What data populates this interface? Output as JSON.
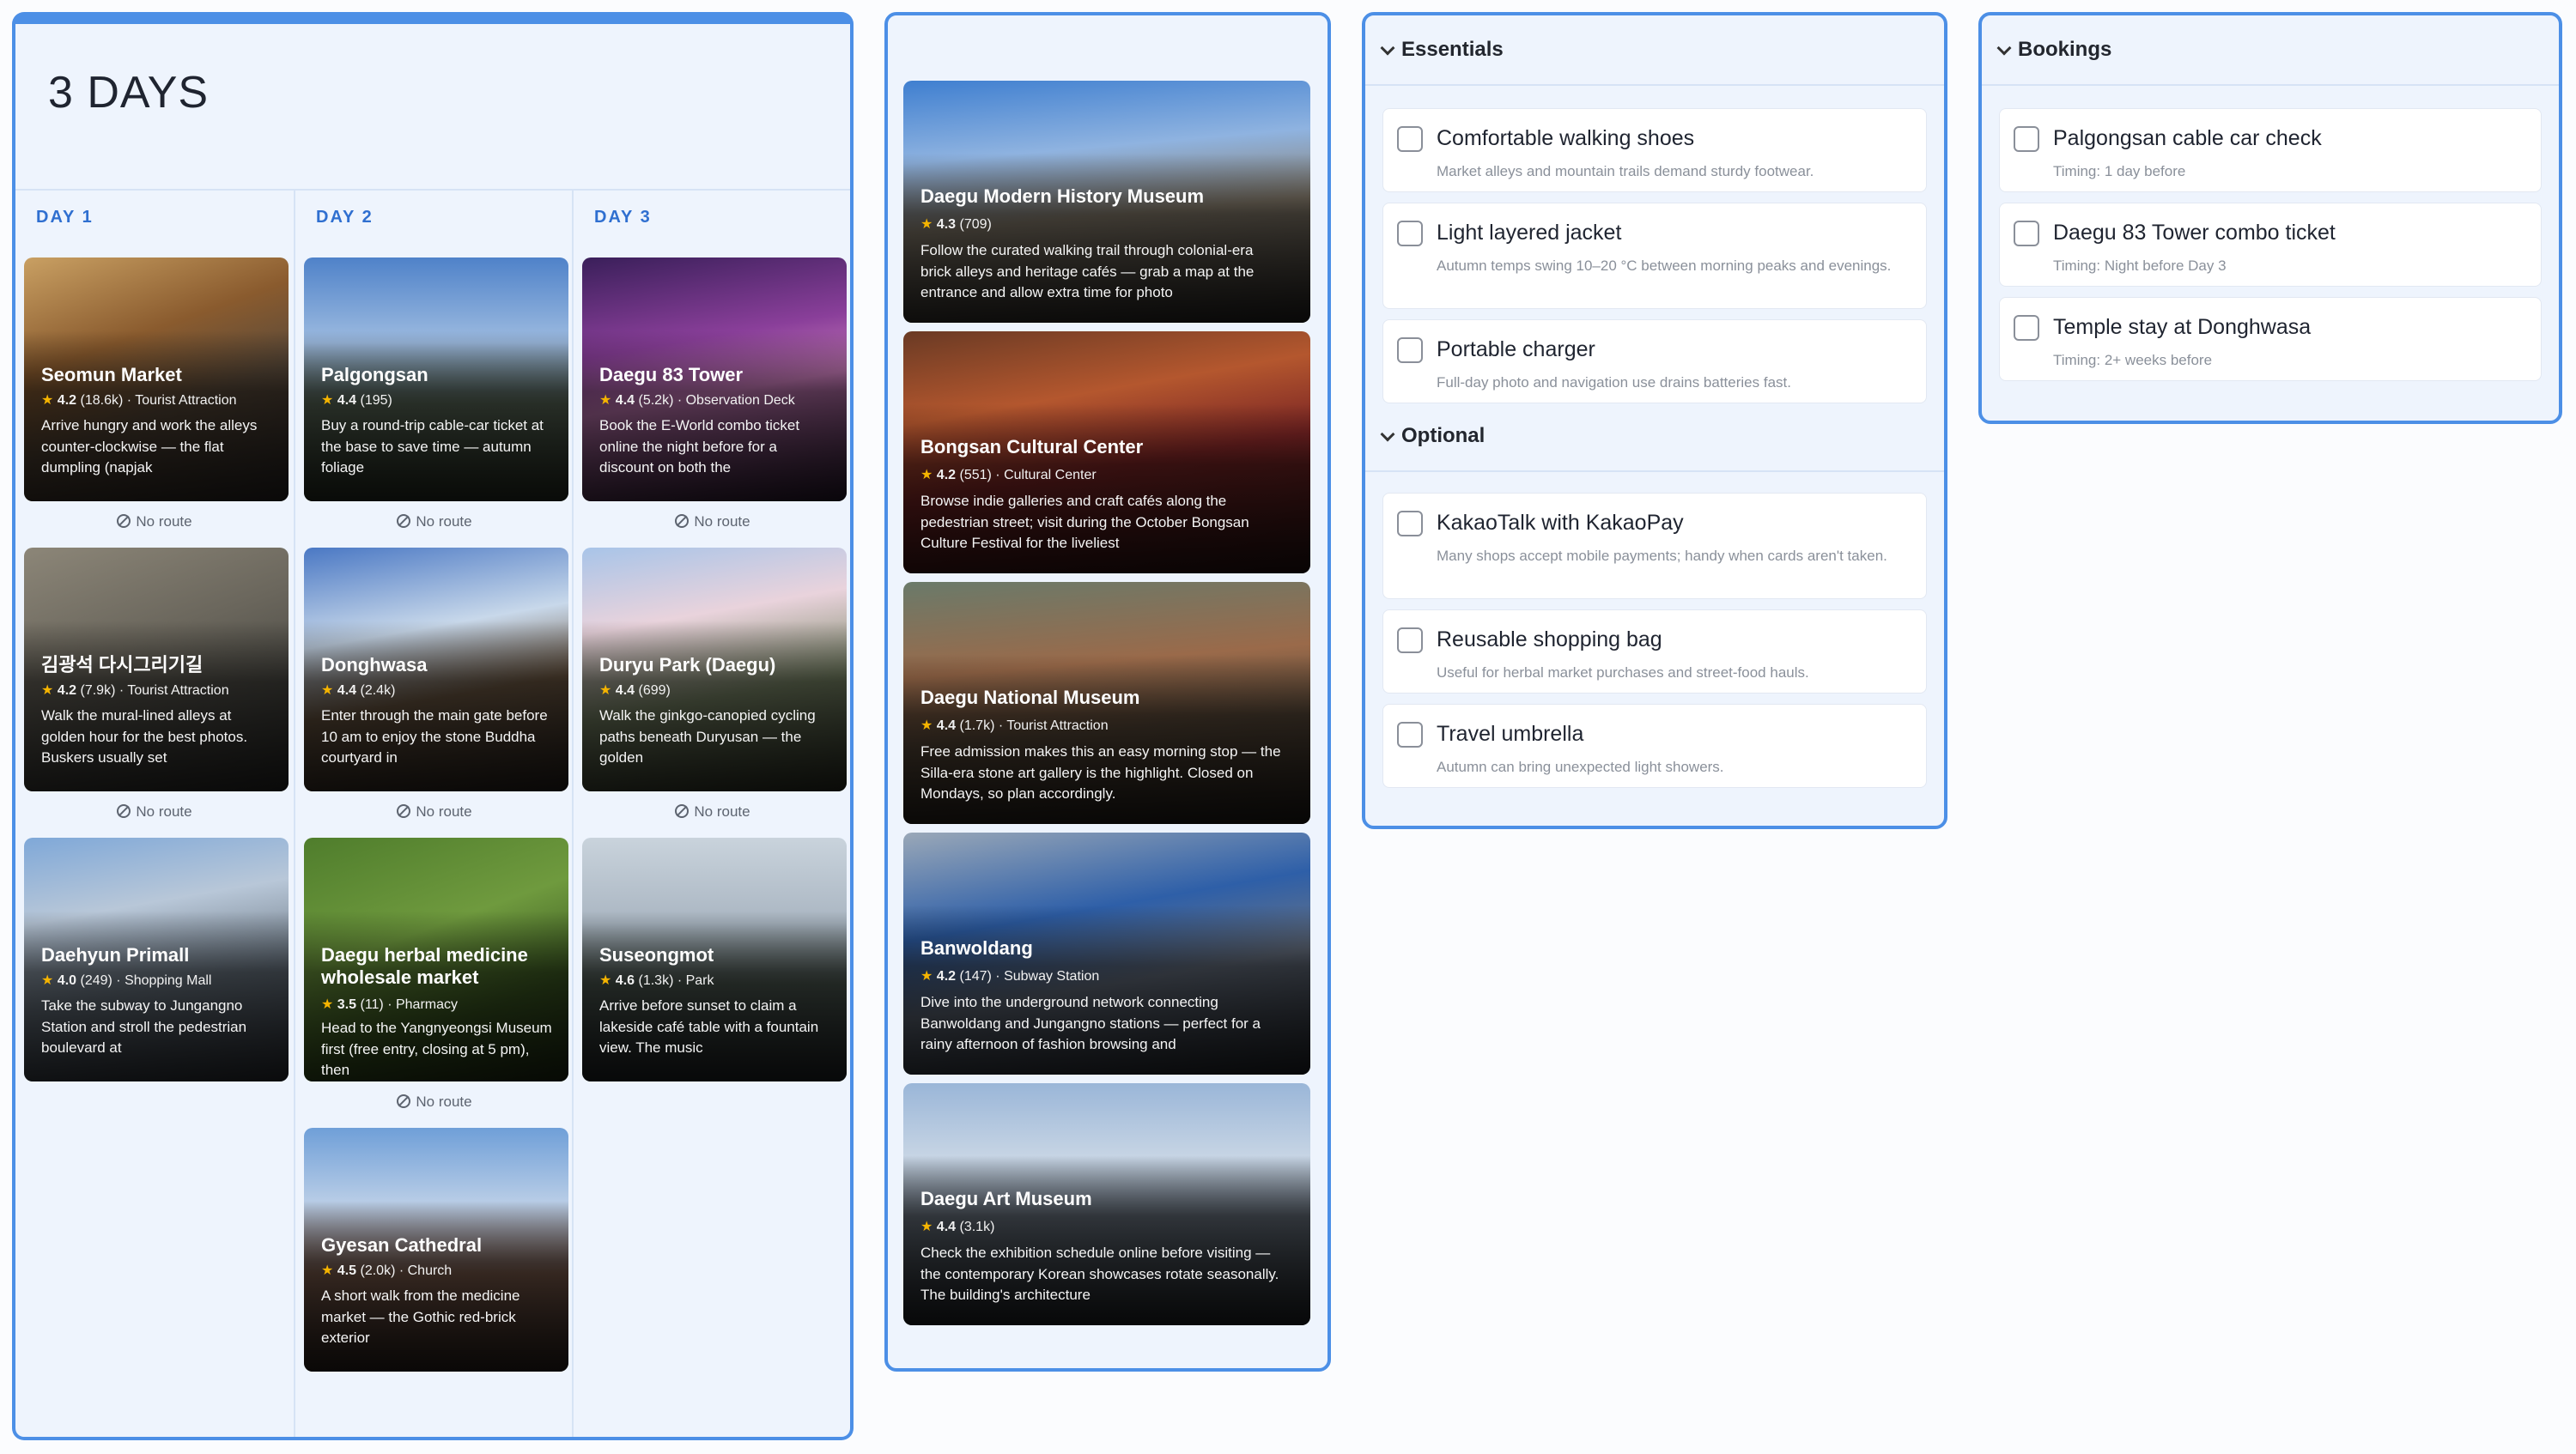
{
  "itinerary": {
    "title": "3 DAYS",
    "no_route_label": "No route",
    "days": [
      {
        "label": "DAY 1",
        "cards": [
          {
            "name": "Seomun Market",
            "rating": "4.2",
            "reviews": "(18.6k)",
            "category": "Tourist Attraction",
            "desc": "Arrive hungry and work the alleys counter-clockwise — the flat dumpling (napjak",
            "bg": "linear-gradient(160deg,#c9a063 0%,#8a5b2e 35%,#5a4a3a 60%,#2e2a28 100%)"
          },
          {
            "name": "김광석 다시그리기길",
            "rating": "4.2",
            "reviews": "(7.9k)",
            "category": "Tourist Attraction",
            "desc": "Walk the mural-lined alleys at golden hour for the best photos. Buskers usually set",
            "bg": "linear-gradient(160deg,#8c8678 0%,#6a665c 40%,#4b4a44 70%,#2c2c2a 100%)"
          },
          {
            "name": "Daehyun Primall",
            "rating": "4.0",
            "reviews": "(249)",
            "category": "Shopping Mall",
            "desc": "Take the subway to Jungangno Station and stroll the pedestrian boulevard at",
            "bg": "linear-gradient(170deg,#7fa8d8 0%,#b8c7d8 30%,#6e7a86 60%,#2e3238 100%)"
          }
        ]
      },
      {
        "label": "DAY 2",
        "cards": [
          {
            "name": "Palgongsan",
            "rating": "4.4",
            "reviews": "(195)",
            "category": "",
            "desc": "Buy a round-trip cable-car ticket at the base to save time — autumn foliage",
            "bg": "linear-gradient(180deg,#4f82c9 0%,#9dbbe0 35%,#5c6b5a 60%,#2b3326 100%)"
          },
          {
            "name": "Donghwasa",
            "rating": "4.4",
            "reviews": "(2.4k)",
            "category": "",
            "desc": "Enter through the main gate before 10 am to enjoy the stone Buddha courtyard in",
            "bg": "linear-gradient(170deg,#4a78c4 0%,#c8d8ea 35%,#6f5a44 60%,#2a2420 100%)"
          },
          {
            "name": "Daegu herbal medicine wholesale market",
            "rating": "3.5",
            "reviews": "(11)",
            "category": "Pharmacy",
            "desc": "Head to the Yangnyeongsi Museum first (free entry, closing at 5 pm), then",
            "bg": "linear-gradient(160deg,#4f7d2c 0%,#6f9a3e 40%,#3c5a22 70%,#1f2c14 100%)"
          },
          {
            "name": "Gyesan Cathedral",
            "rating": "4.5",
            "reviews": "(2.0k)",
            "category": "Church",
            "desc": "A short walk from the medicine market — the Gothic red-brick exterior",
            "bg": "linear-gradient(180deg,#6f9fd8 0%,#b7cce6 30%,#7a5a4a 60%,#2e2420 100%)"
          }
        ]
      },
      {
        "label": "DAY 3",
        "cards": [
          {
            "name": "Daegu 83 Tower",
            "rating": "4.4",
            "reviews": "(5.2k)",
            "category": "Observation Deck",
            "desc": "Book the E-World combo ticket online the night before for a discount on both the",
            "bg": "linear-gradient(170deg,#3a1f5a 0%,#8a3f9a 35%,#c77ab8 55%,#2a1a30 100%)"
          },
          {
            "name": "Duryu Park (Daegu)",
            "rating": "4.4",
            "reviews": "(699)",
            "category": "",
            "desc": "Walk the ginkgo-canopied cycling paths beneath Duryusan — the golden",
            "bg": "linear-gradient(170deg,#a8c4e8 0%,#e9d3dc 30%,#7d8a6a 60%,#2e3226 100%)"
          },
          {
            "name": "Suseongmot",
            "rating": "4.6",
            "reviews": "(1.3k)",
            "category": "Park",
            "desc": "Arrive before sunset to claim a lakeside café table with a fountain view. The music",
            "bg": "linear-gradient(180deg,#c9d3dc 0%,#aab6c2 35%,#4e5a52 60%,#23282a 100%)"
          }
        ]
      }
    ]
  },
  "suggestions": [
    {
      "name": "Daegu Modern History Museum",
      "rating": "4.3",
      "reviews": "(709)",
      "category": "",
      "desc": "Follow the curated walking trail through colonial-era brick alleys and heritage cafés — grab a map at the entrance and allow extra time for photo",
      "bg": "linear-gradient(175deg,#3f7fd0 0%,#8fb3e0 30%,#8a8070 55%,#2c2a28 100%)"
    },
    {
      "name": "Bongsan Cultural Center",
      "rating": "4.2",
      "reviews": "(551)",
      "category": "Cultural Center",
      "desc": "Browse indie galleries and craft cafés along the pedestrian street; visit during the October Bongsan Culture Festival for the liveliest",
      "bg": "linear-gradient(170deg,#6a3a24 0%,#b4572e 30%,#7a2424 55%,#2a1414 100%)"
    },
    {
      "name": "Daegu National Museum",
      "rating": "4.4",
      "reviews": "(1.7k)",
      "category": "Tourist Attraction",
      "desc": "Free admission makes this an easy morning stop — the Silla-era stone art gallery is the highlight. Closed on Mondays, so plan accordingly.",
      "bg": "linear-gradient(175deg,#6a7a6a 0%,#9a6a4a 35%,#5a4a3a 60%,#24201c 100%)"
    },
    {
      "name": "Banwoldang",
      "rating": "4.2",
      "reviews": "(147)",
      "category": "Subway Station",
      "desc": "Dive into the underground network connecting Banwoldang and Jungangno stations — perfect for a rainy afternoon of fashion browsing and",
      "bg": "linear-gradient(170deg,#9aa8b8 0%,#2e5fa8 35%,#6a7484 60%,#262a30 100%)"
    },
    {
      "name": "Daegu Art Museum",
      "rating": "4.4",
      "reviews": "(3.1k)",
      "category": "",
      "desc": "Check the exhibition schedule online before visiting — the contemporary Korean showcases rotate seasonally. The building's architecture",
      "bg": "linear-gradient(180deg,#9ab6d8 0%,#c6d4e4 30%,#6a7480 55%,#262a2e 100%)"
    }
  ],
  "essentials": {
    "header": "Essentials",
    "items": [
      {
        "title": "Comfortable walking shoes",
        "sub": "Market alleys and mountain trails demand sturdy footwear."
      },
      {
        "title": "Light layered jacket",
        "sub": "Autumn temps swing 10–20 °C between morning peaks and evenings."
      },
      {
        "title": "Portable charger",
        "sub": "Full-day photo and navigation use drains batteries fast."
      }
    ]
  },
  "optional": {
    "header": "Optional",
    "items": [
      {
        "title": "KakaoTalk with KakaoPay",
        "sub": "Many shops accept mobile payments; handy when cards aren't taken."
      },
      {
        "title": "Reusable shopping bag",
        "sub": "Useful for herbal market purchases and street-food hauls."
      },
      {
        "title": "Travel umbrella",
        "sub": "Autumn can bring unexpected light showers."
      }
    ]
  },
  "bookings": {
    "header": "Bookings",
    "items": [
      {
        "title": "Palgongsan cable car check",
        "sub": "Timing: 1 day before"
      },
      {
        "title": "Daegu 83 Tower combo ticket",
        "sub": "Timing: Night before Day 3"
      },
      {
        "title": "Temple stay at Donghwasa",
        "sub": "Timing: 2+ weeks before"
      }
    ]
  },
  "colors": {
    "accent": "#4c8fe6",
    "day_label": "#2f6fd0",
    "star": "#f5b400",
    "panel_bg": "#eef4fd"
  },
  "icons": {
    "no_route": "no-route-icon",
    "chevron": "chevron-down-icon",
    "star": "star-icon",
    "checkbox": "checkbox-icon"
  }
}
